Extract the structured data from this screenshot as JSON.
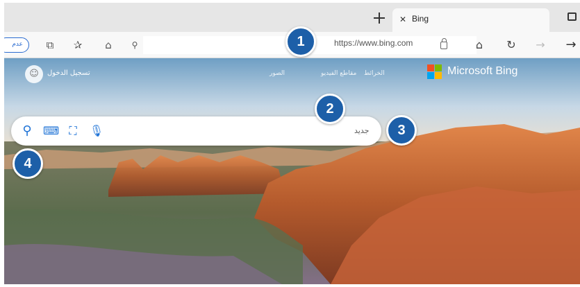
{
  "browser": {
    "tab": {
      "title": "Bing",
      "close_glyph": "✕"
    },
    "new_tab_icon": "plus-icon",
    "address": {
      "url": "https://www.bing.com",
      "left_pill_text": "عدم"
    }
  },
  "page": {
    "signin_text": "تسجيل الدخول",
    "nav_items": [
      "الصور",
      "مقاطع الفيديو",
      "الخرائط"
    ],
    "brand_name": "Microsoft Bing",
    "search": {
      "placeholder": "جديد"
    },
    "logo_colors": [
      "#f25022",
      "#7fba00",
      "#00a4ef",
      "#ffb900"
    ]
  },
  "callouts": [
    "1",
    "2",
    "3",
    "4"
  ],
  "accent_color": "#1d5fa8"
}
